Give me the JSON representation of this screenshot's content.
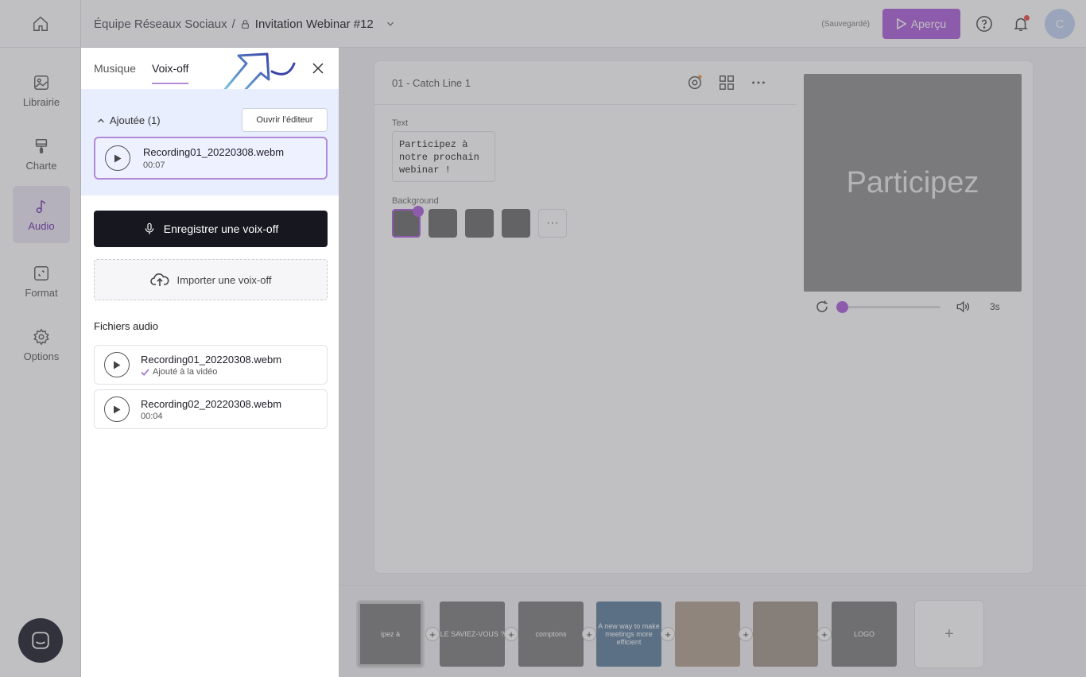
{
  "header": {
    "breadcrumb_team": "Équipe Réseaux Sociaux",
    "separator": "/",
    "project_title": "Invitation Webinar #12",
    "saved_status": "(Sauvegardé)",
    "preview_label": "Aperçu",
    "avatar_initial": "C"
  },
  "nav": {
    "items": [
      {
        "label": "Librairie",
        "icon": "library-icon"
      },
      {
        "label": "Charte",
        "icon": "brush-icon"
      },
      {
        "label": "Audio",
        "icon": "music-note-icon"
      },
      {
        "label": "Format",
        "icon": "format-icon"
      },
      {
        "label": "Options",
        "icon": "gear-icon"
      }
    ]
  },
  "scene": {
    "title": "01 - Catch Line 1",
    "text_label": "Text",
    "text_value": "Participez à\nnotre prochain\nwebinar !",
    "background_label": "Background",
    "more": "···",
    "preview_text": "Participez",
    "duration": "3s"
  },
  "timeline": {
    "thumbs": [
      {
        "text": "ipez à"
      },
      {
        "text": "LE SAVIEZ-VOUS ?"
      },
      {
        "text": "comptons"
      },
      {
        "text": "A new way to make meetings more efficient"
      },
      {
        "text": ""
      },
      {
        "text": ""
      },
      {
        "text": "LOGO"
      }
    ],
    "plus": "+"
  },
  "panel": {
    "tabs": [
      "Musique",
      "Voix-off"
    ],
    "added_header": "Ajoutée (1)",
    "open_editor": "Ouvrir l'éditeur",
    "added_file": {
      "name": "Recording01_20220308.webm",
      "duration": "00:07"
    },
    "record_label": "Enregistrer une voix-off",
    "import_label": "Importer une voix-off",
    "files_title": "Fichiers audio",
    "files": [
      {
        "name": "Recording01_20220308.webm",
        "sub": "Ajouté à la vidéo"
      },
      {
        "name": "Recording02_20220308.webm",
        "sub": "00:04"
      }
    ]
  },
  "colors": {
    "accent": "#b46adf",
    "highlight_bg": "#e9eefe",
    "dark_button": "#17171f"
  }
}
